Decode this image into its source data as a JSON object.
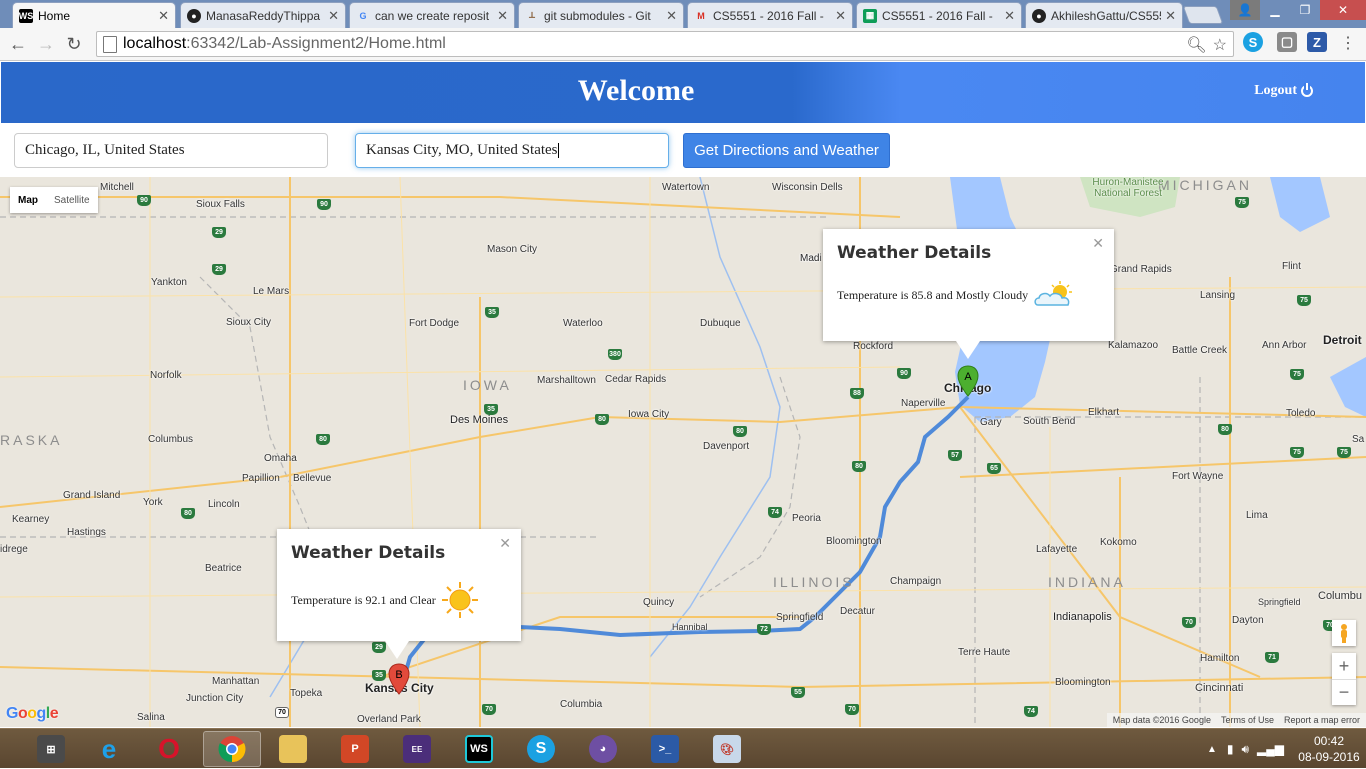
{
  "browser": {
    "tabs": [
      {
        "label": "Home",
        "favicon": "WS"
      },
      {
        "label": "ManasaReddyThippa",
        "favicon": "github"
      },
      {
        "label": "can we create reposit",
        "favicon": "G"
      },
      {
        "label": "git submodules - Git",
        "favicon": "git"
      },
      {
        "label": "CS5551 - 2016 Fall -",
        "favicon": "M"
      },
      {
        "label": "CS5551 - 2016 Fall -",
        "favicon": "sheet"
      },
      {
        "label": "AkhileshGattu/CS555",
        "favicon": "github"
      }
    ],
    "url_host": "localhost",
    "url_path": ":63342/Lab-Assignment2/Home.html"
  },
  "header": {
    "title": "Welcome",
    "logout_label": "Logout"
  },
  "form": {
    "origin_value": "Chicago, IL, United States",
    "destination_value": "Kansas City, MO, United States",
    "submit_label": "Get Directions and Weather"
  },
  "map": {
    "type_options": [
      "Map",
      "Satellite"
    ],
    "selected_type": "Map",
    "places": [
      "Mitchell",
      "Sioux Falls",
      "Watertown",
      "Wisconsin Dells",
      "Mason City",
      "Yankton",
      "Le Mars",
      "Sioux City",
      "Fort Dodge",
      "Waterloo",
      "Dubuque",
      "Norfolk",
      "Marshalltown",
      "Cedar Rapids",
      "Des Moines",
      "Iowa City",
      "Columbus",
      "Omaha",
      "Papillion",
      "Bellevue",
      "Davenport",
      "Grand Island",
      "York",
      "Lincoln",
      "Kearney",
      "Hastings",
      "Beatrice",
      "Peoria",
      "Bloomington",
      "Quincy",
      "Hannibal",
      "Springfield",
      "Decatur",
      "Champaign",
      "Manhattan",
      "Junction City",
      "Topeka",
      "Kansas City",
      "Overland Park",
      "Salina",
      "Columbia",
      "Rockford",
      "Naperville",
      "Chicago",
      "Gary",
      "South Bend",
      "Elkhart",
      "Kalamazoo",
      "Battle Creek",
      "Ann Arbor",
      "Detroit",
      "Toledo",
      "Fort Wayne",
      "Lima",
      "Lafayette",
      "Kokomo",
      "Indianapolis",
      "Terre Haute",
      "Bloomington",
      "Cincinnati",
      "Hamilton",
      "Dayton",
      "Springfield",
      "Columbu",
      "Grand Rapids",
      "Flint",
      "Lansing",
      "Madi",
      "Huron-Manistee National Forest",
      "Mad",
      "idrege",
      "Sa"
    ],
    "states": [
      "IOWA",
      "ILLINOIS",
      "INDIANA",
      "MICHIGAN",
      "RASKA"
    ],
    "markers": [
      {
        "label": "A",
        "color": "#4caf2f"
      },
      {
        "label": "B",
        "color": "#e24a3b"
      }
    ],
    "info_windows": [
      {
        "title": "Weather Details",
        "text": "Temperature is 85.8 and Mostly Cloudy",
        "icon": "partly-cloudy-icon"
      },
      {
        "title": "Weather Details",
        "text": "Temperature is 92.1 and Clear",
        "icon": "sun-icon"
      }
    ],
    "attribution": [
      "Map data ©2016 Google",
      "Terms of Use",
      "Report a map error"
    ],
    "route_color": "#4f8ad9"
  },
  "taskbar": {
    "time": "00:42",
    "date": "08-09-2016"
  }
}
